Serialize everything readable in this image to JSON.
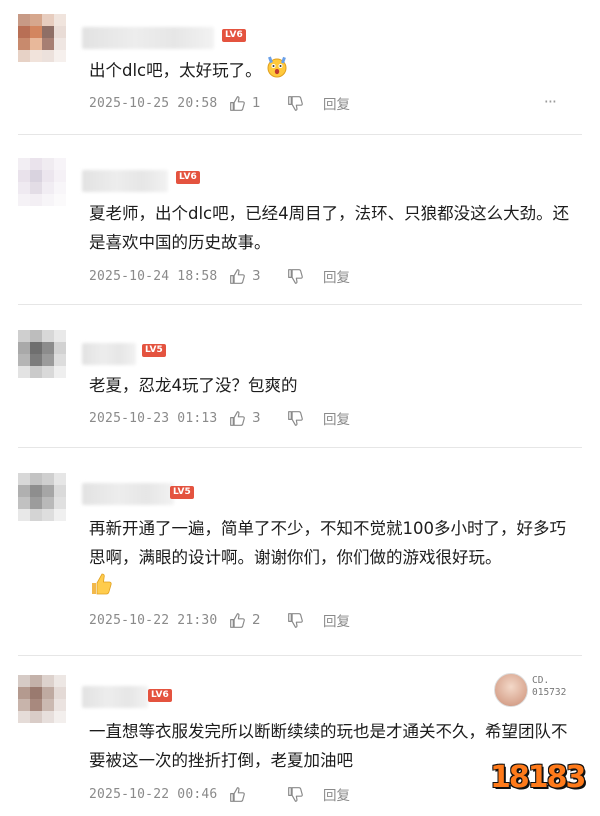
{
  "colors": {
    "level_badge": "#e4533f",
    "meta_text": "#8a8a8a",
    "logo": "#ff7a1a"
  },
  "comments": [
    {
      "level": "LV6",
      "text": "出个dlc吧，太好玩了。",
      "emoji": "shocked-face-icon",
      "date": "2025-10-25 20:58",
      "likes": "1",
      "reply": "回复",
      "more": "···"
    },
    {
      "level": "LV6",
      "text": "夏老师，出个dlc吧，已经4周目了，法环、只狼都没这么大劲。还是喜欢中国的历史故事。",
      "date": "2025-10-24 18:58",
      "likes": "3",
      "reply": "回复"
    },
    {
      "level": "LV5",
      "text": "老夏，忍龙4玩了没？包爽的",
      "date": "2025-10-23 01:13",
      "likes": "3",
      "reply": "回复"
    },
    {
      "level": "LV5",
      "text": "再新开通了一遍，简单了不少，不知不觉就100多小时了，好多巧思啊，满眼的设计啊。谢谢你们，你们做的游戏很好玩。",
      "emoji": "thumbs-up-icon",
      "date": "2025-10-22 21:30",
      "likes": "2",
      "reply": "回复"
    },
    {
      "level": "LV6",
      "text": "一直想等衣服发完所以断断续续的玩也是才通关不久，希望团队不要被这一次的挫折打倒，老夏加油吧",
      "date": "2025-10-22 00:46",
      "reply": "回复"
    }
  ],
  "fan_badge": {
    "line1": "CD.",
    "line2": "015732"
  },
  "logo": {
    "text": "18183"
  }
}
